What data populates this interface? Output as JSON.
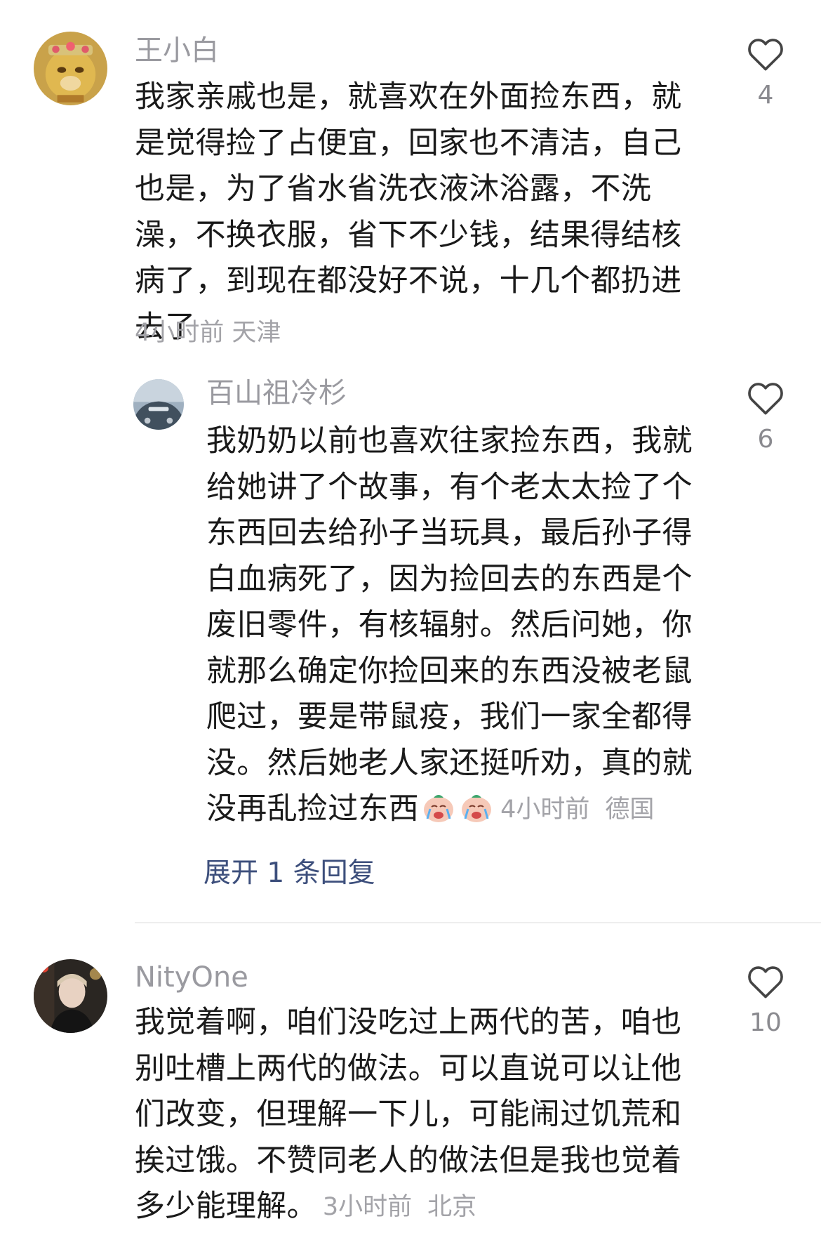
{
  "comments": [
    {
      "username": "王小白",
      "text": "我家亲戚也是，就喜欢在外面捡东西，就是觉得捡了占便宜，回家也不清洁，自己也是，为了省水省洗衣液沐浴露，不洗澡，不换衣服，省下不少钱，结果得结核病了，到现在都没好不说，十几个都扔进去了",
      "time": "4小时前",
      "location": "天津",
      "likes": "4"
    },
    {
      "username": "NityOne",
      "text": "我觉着啊，咱们没吃过上两代的苦，咱也别吐槽上两代的做法。可以直说可以让他们改变，但理解一下儿，可能闹过饥荒和挨过饿。不赞同老人的做法但是我也觉着多少能理解。",
      "time": "3小时前",
      "location": "北京",
      "likes": "10"
    }
  ],
  "reply": {
    "username": "百山祖冷杉",
    "text": "我奶奶以前也喜欢往家捡东西，我就给她讲了个故事，有个老太太捡了个东西回去给孙子当玩具，最后孙子得白血病死了，因为捡回去的东西是个废旧零件，有核辐射。然后问她，你就那么确定你捡回来的东西没被老鼠爬过，要是带鼠疫，我们一家全都得没。然后她老人家还挺听劝，真的就没再乱捡过东西",
    "emojis": [
      "crying-face-emoji",
      "crying-face-emoji"
    ],
    "time": "4小时前",
    "location": "德国",
    "likes": "6",
    "expand_label": "展开 1 条回复"
  },
  "colors": {
    "username": "#9a9aa0",
    "text": "#1a1a1a",
    "meta": "#a3a3a8",
    "link": "#3d4f7c",
    "divider": "#eeeeee"
  }
}
